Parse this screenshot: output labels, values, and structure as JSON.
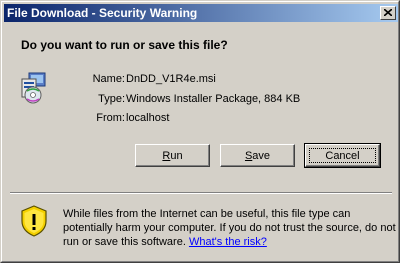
{
  "window": {
    "title": "File Download - Security Warning"
  },
  "dialog": {
    "question": "Do you want to run or save this file?",
    "file": {
      "icon": "msi-installer-icon",
      "name_label": "Name:",
      "name_value": "DnDD_V1R4e.msi",
      "type_label": "Type:",
      "type_value": "Windows Installer Package, 884 KB",
      "from_label": "From:",
      "from_value": "localhost"
    },
    "buttons": {
      "run": {
        "accel": "R",
        "rest": "un"
      },
      "save": {
        "accel": "S",
        "rest": "ave"
      },
      "cancel": "Cancel"
    },
    "warning": {
      "icon": "shield-warning-icon",
      "text": "While files from the Internet can be useful, this file type can potentially harm your computer. If you do not trust the source, do not run or save this software.",
      "link": "What's the risk?"
    }
  },
  "colors": {
    "titlebar_start": "#0a246a",
    "titlebar_end": "#a6caf0",
    "face": "#d4d0c8",
    "link": "#0000ff"
  }
}
